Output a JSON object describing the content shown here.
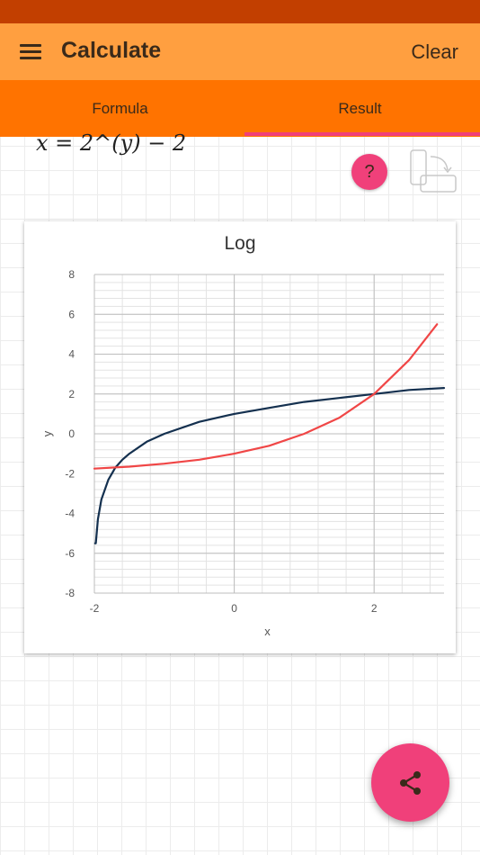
{
  "app_bar": {
    "title": "Calculate",
    "clear_label": "Clear",
    "menu_icon": "menu-icon"
  },
  "tabs": [
    {
      "label": "Formula",
      "selected": false
    },
    {
      "label": "Result",
      "selected": true
    }
  ],
  "formula": {
    "display": "x = 2^(y) − 2"
  },
  "help": {
    "label": "?",
    "icon": "help-icon"
  },
  "rotate_icon": "screen-rotation-icon",
  "share_icon": "share-icon",
  "colors": {
    "status_bar": "#c23f00",
    "app_bar": "#ff9f40",
    "tab_bar": "#ff7300",
    "accent": "#f0407a",
    "series_log": "#14304f",
    "series_formula": "#f04646"
  },
  "chart_data": {
    "type": "line",
    "title": "Log",
    "xlabel": "x",
    "ylabel": "y",
    "xlim": [
      -2,
      3
    ],
    "ylim": [
      -8,
      8
    ],
    "x_ticks": [
      "-2",
      "0",
      "2"
    ],
    "y_ticks": [
      "8",
      "6",
      "4",
      "2",
      "0",
      "-2",
      "-4",
      "-6",
      "-8"
    ],
    "grid": true,
    "legend": "none",
    "series": [
      {
        "color": "#14304f",
        "x": [
          -1.99,
          -1.98,
          -1.95,
          -1.9,
          -1.8,
          -1.7,
          -1.6,
          -1.5,
          -1.25,
          -1.0,
          -0.5,
          0,
          0.5,
          1.0,
          1.5,
          2.0,
          2.5,
          3.0
        ],
        "y": [
          -5.5,
          -5.5,
          -4.3,
          -3.3,
          -2.3,
          -1.7,
          -1.3,
          -1.0,
          -0.4,
          0.0,
          0.6,
          1.0,
          1.3,
          1.6,
          1.8,
          2.0,
          2.2,
          2.3
        ]
      },
      {
        "color": "#f04646",
        "x": [
          -2,
          -1.5,
          -1.0,
          -0.5,
          0,
          0.5,
          1.0,
          1.5,
          2.0,
          2.5,
          2.9
        ],
        "y": [
          -1.75,
          -1.65,
          -1.5,
          -1.3,
          -1.0,
          -0.6,
          0.0,
          0.8,
          2.0,
          3.7,
          5.5
        ]
      }
    ]
  }
}
